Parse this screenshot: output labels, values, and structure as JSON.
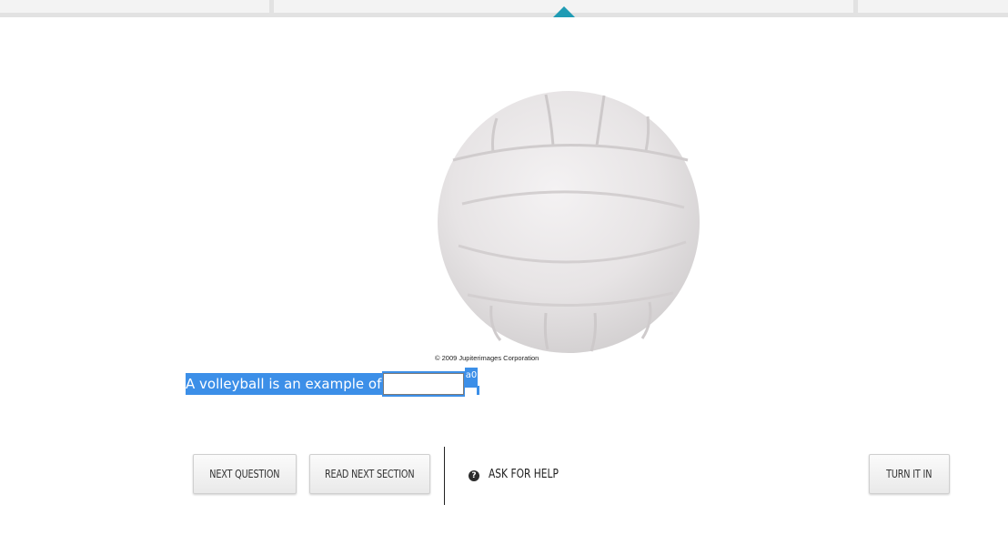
{
  "question": {
    "prompt": "A volleyball is an example of a",
    "answer_value": "",
    "answer_placeholder": "",
    "trailing_marker": "a0"
  },
  "image": {
    "alt": "volleyball",
    "credit": "© 2009 Jupiterimages Corporation"
  },
  "toolbar": {
    "next_question": "NEXT QUESTION",
    "read_next_section": "READ NEXT SECTION",
    "ask_for_help": "ASK FOR HELP",
    "turn_it_in": "TURN IT IN"
  },
  "icons": {
    "help": "question-circle-icon",
    "current_tab": "triangle-up-icon"
  },
  "colors": {
    "selection": "#3c8fe8",
    "tab_marker": "#1f9bb4"
  }
}
